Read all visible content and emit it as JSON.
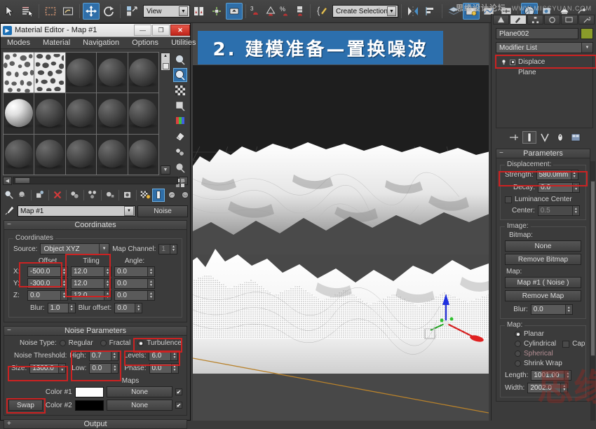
{
  "app": {
    "watermark_cn": "思缘设计论坛",
    "watermark_en": "WWW.MISSYUAN.COM",
    "big_watermark": "思缘"
  },
  "toolbar": {
    "coord_system_value": "View",
    "selection_set_value": "Create Selection Se",
    "buttons": [
      {
        "name": "select-object-icon",
        "label": "Select Object"
      },
      {
        "name": "select-by-name-icon",
        "label": "Select by Name"
      },
      {
        "name": "rectangular-selection-region-icon",
        "label": "Rectangular Selection Region"
      },
      {
        "name": "window-crossing-icon",
        "label": "Window / Crossing"
      },
      {
        "name": "select-and-move-icon",
        "label": "Select and Move"
      },
      {
        "name": "select-and-rotate-icon",
        "label": "Select and Rotate"
      },
      {
        "name": "select-and-scale-icon",
        "label": "Select and Uniform Scale"
      },
      {
        "name": "use-pivot-center-icon",
        "label": "Use Pivot Point Center"
      },
      {
        "name": "select-and-manipulate-icon",
        "label": "Select and Manipulate"
      },
      {
        "name": "snap-toggle-icon",
        "label": "Snaps Toggle 3"
      },
      {
        "name": "angle-snap-icon",
        "label": "Angle Snap Toggle"
      },
      {
        "name": "percent-snap-icon",
        "label": "Percent Snap Toggle"
      },
      {
        "name": "spinner-snap-icon",
        "label": "Spinner Snap Toggle"
      },
      {
        "name": "named-selection-icon",
        "label": "Edit Named Selection Sets"
      },
      {
        "name": "mirror-icon",
        "label": "Mirror"
      },
      {
        "name": "align-icon",
        "label": "Align"
      },
      {
        "name": "layer-manager-icon",
        "label": "Layer Manager"
      },
      {
        "name": "curve-editor-icon",
        "label": "Curve Editor"
      },
      {
        "name": "schematic-view-icon",
        "label": "Schematic View"
      },
      {
        "name": "material-editor-icon",
        "label": "Material Editor"
      },
      {
        "name": "render-setup-icon",
        "label": "Render Setup"
      },
      {
        "name": "rendered-frame-icon",
        "label": "Rendered Frame Window"
      },
      {
        "name": "render-production-icon",
        "label": "Render Production"
      }
    ]
  },
  "viewport": {
    "banner_text": "2. 建模准备—置换噪波",
    "gizmo": {
      "x_axis": "X",
      "y_axis": "Y",
      "z_axis": "Z"
    }
  },
  "material_editor": {
    "title": "Material Editor - Map #1",
    "window_buttons": {
      "minimize": "—",
      "maximize": "❐",
      "close": "✕"
    },
    "menu": [
      "Modes",
      "Material",
      "Navigation",
      "Options",
      "Utilities"
    ],
    "slots": [
      {
        "type": "noise",
        "selected": false
      },
      {
        "type": "noise",
        "selected": true
      },
      {
        "type": "sphere-dark",
        "selected": false
      },
      {
        "type": "sphere-dark",
        "selected": false
      },
      {
        "type": "sphere-dark",
        "selected": false
      },
      {
        "type": "sphere-bright",
        "selected": false
      },
      {
        "type": "sphere-dark",
        "selected": false
      },
      {
        "type": "sphere-dark",
        "selected": false
      },
      {
        "type": "sphere-dark",
        "selected": false
      },
      {
        "type": "sphere-dark",
        "selected": false
      },
      {
        "type": "sphere-dark",
        "selected": false
      },
      {
        "type": "sphere-dark",
        "selected": false
      },
      {
        "type": "sphere-dark",
        "selected": false
      },
      {
        "type": "sphere-dark",
        "selected": false
      },
      {
        "type": "sphere-dark",
        "selected": false
      }
    ],
    "map_name": "Map #1",
    "map_type": "Noise",
    "coordinates": {
      "rollout_title": "Coordinates",
      "group_label": "Coordinates",
      "source_label": "Source:",
      "source_value": "Object XYZ",
      "map_channel_label": "Map Channel:",
      "map_channel_value": "1",
      "offset_header": "Offset",
      "tiling_header": "Tiling",
      "angle_header": "Angle:",
      "x_label": "X:",
      "y_label": "Y:",
      "z_label": "Z:",
      "offset_x": "-500.0",
      "offset_y": "-300.0",
      "offset_z": "0.0",
      "tiling_x": "12.0",
      "tiling_y": "12.0",
      "tiling_z": "12.0",
      "angle_x": "0.0",
      "angle_y": "0.0",
      "angle_z": "0.0",
      "blur_label": "Blur:",
      "blur_value": "1.0",
      "blur_offset_label": "Blur offset:",
      "blur_offset_value": "0.0"
    },
    "noise_parameters": {
      "rollout_title": "Noise Parameters",
      "noise_type_label": "Noise Type:",
      "type_regular": "Regular",
      "type_fractal": "Fractal",
      "type_turbulence": "Turbulence",
      "selected_type": "Turbulence",
      "noise_threshold_label": "Noise Threshold:",
      "high_label": "High:",
      "high_value": "0.7",
      "low_label": "Low:",
      "low_value": "0.0",
      "levels_label": "Levels:",
      "levels_value": "6.0",
      "phase_label": "Phase:",
      "phase_value": "0.0",
      "size_label": "Size:",
      "size_value": "1300.0",
      "maps_header": "Maps",
      "swap_label": "Swap",
      "color1_label": "Color #1",
      "color1_hex": "#ffffff",
      "color1_map": "None",
      "color2_label": "Color #2",
      "color2_hex": "#000000",
      "color2_map": "None"
    },
    "output": {
      "rollout_title": "Output"
    }
  },
  "command_panel": {
    "object_name": "Plane002",
    "object_color": "#8a9b2a",
    "modifier_list_label": "Modifier List",
    "stack": [
      {
        "label": "Displace",
        "selected": true
      },
      {
        "label": "Plane",
        "selected": false
      }
    ],
    "stack_tools": [
      {
        "name": "pin-stack-icon"
      },
      {
        "name": "show-end-result-icon"
      },
      {
        "name": "make-unique-icon"
      },
      {
        "name": "remove-modifier-icon"
      },
      {
        "name": "configure-modifier-sets-icon"
      }
    ],
    "parameters": {
      "rollout_title": "Parameters",
      "displacement_label": "Displacement:",
      "strength_label": "Strength:",
      "strength_value": "580.0mm",
      "decay_label": "Decay:",
      "decay_value": "0.0",
      "luminance_center_label": "Luminance Center",
      "luminance_center_checked": false,
      "center_label": "Center:",
      "center_value": "0.5",
      "image_label": "Image:",
      "bitmap_label": "Bitmap:",
      "bitmap_button": "None",
      "remove_bitmap_button": "Remove Bitmap",
      "map_label": "Map:",
      "map_button": "Map #1  ( Noise )",
      "remove_map_button": "Remove Map",
      "blur_label": "Blur:",
      "blur_value": "0.0",
      "map_group_label": "Map:",
      "map_planar": "Planar",
      "map_cylindrical": "Cylindrical",
      "map_cap": "Cap",
      "map_spherical": "Spherical",
      "map_shrink_wrap": "Shrink Wrap",
      "selected_map_type": "Planar",
      "length_label": "Length:",
      "length_value": "1001.00",
      "width_label": "Width:",
      "width_value": "2002.0"
    }
  }
}
